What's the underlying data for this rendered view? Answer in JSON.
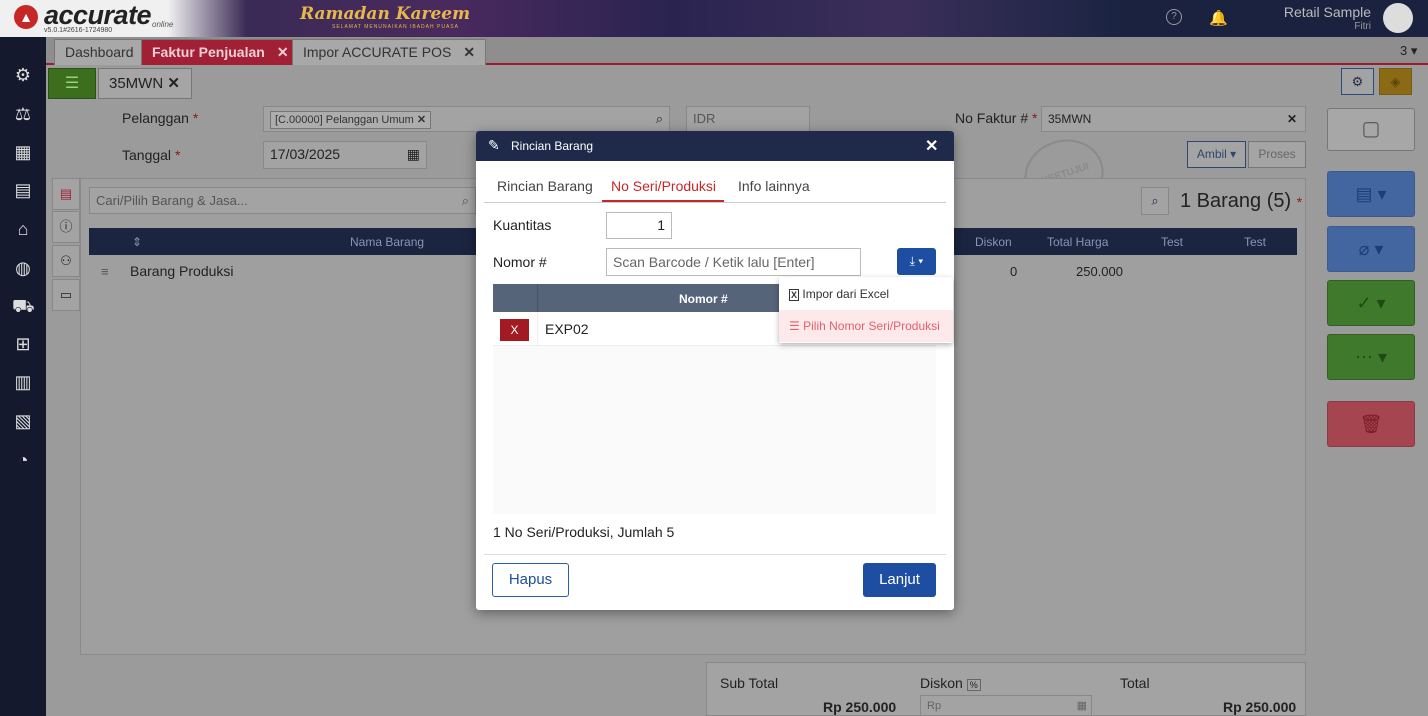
{
  "app": {
    "logo_text": "accurate",
    "logo_sub": "online",
    "version": "v5.0.1#2616-1724980",
    "banner_title": "Ramadan Kareem",
    "banner_sub": "SELAMAT MENUNAIKAN IBADAH PUASA",
    "company": "Retail Sample",
    "user": "Fitri"
  },
  "tabs": [
    {
      "label": "Dashboard"
    },
    {
      "label": "Faktur Penjualan"
    },
    {
      "label": "Impor ACCURATE POS"
    }
  ],
  "tab_count": "3",
  "doc_tab": "35MWN",
  "form": {
    "pelanggan_label": "Pelanggan",
    "pelanggan_value": "[C.00000] Pelanggan Umum",
    "currency": "IDR",
    "no_faktur_label": "No Faktur #",
    "no_faktur_value": "35MWN",
    "tanggal_label": "Tanggal",
    "tanggal_value": "17/03/2025",
    "ambil_label": "Ambil",
    "proses_label": "Proses",
    "stamp": "DISETUJUI"
  },
  "items": {
    "search_placeholder": "Cari/Pilih Barang & Jasa...",
    "count_label": "1 Barang (5)",
    "columns": [
      "Nama Barang",
      "Diskon",
      "Total Harga",
      "Test",
      "Test"
    ],
    "rows": [
      {
        "name": "Barang Produksi",
        "diskon": "0",
        "total": "250.000"
      }
    ]
  },
  "totals": {
    "subtotal_label": "Sub Total",
    "subtotal_value": "Rp 250.000",
    "diskon_label": "Diskon",
    "diskon_unit": "%",
    "diskon_placeholder": "Rp",
    "total_label": "Total",
    "total_value": "Rp 250.000"
  },
  "modal": {
    "title": "Rincian Barang",
    "tabs": [
      "Rincian Barang",
      "No Seri/Produksi",
      "Info lainnya"
    ],
    "kuantitas_label": "Kuantitas",
    "kuantitas_value": "1",
    "nomor_label": "Nomor #",
    "nomor_placeholder": "Scan Barcode / Ketik lalu [Enter]",
    "grid_header": "Nomor #",
    "rows": [
      {
        "delete": "X",
        "nomor": "EXP02"
      }
    ],
    "summary": "1 No Seri/Produksi, Jumlah 5",
    "hapus": "Hapus",
    "lanjut": "Lanjut"
  },
  "dropdown": {
    "items": [
      "Impor dari Excel",
      "Pilih Nomor Seri/Produksi"
    ]
  },
  "colors": {
    "accent_red": "#a12036",
    "primary_blue": "#1e4ea1",
    "header_navy": "#1f2a4a"
  }
}
